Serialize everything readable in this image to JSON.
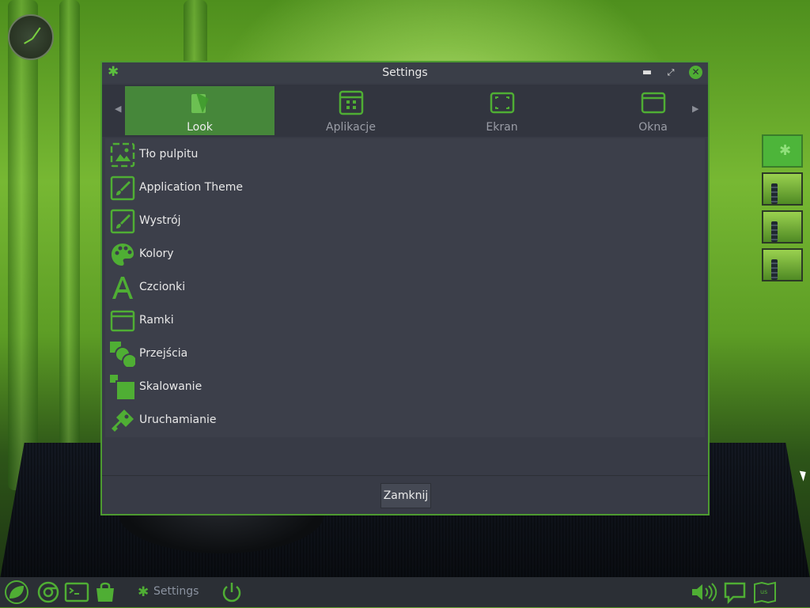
{
  "window": {
    "title": "Settings",
    "close_label": "Zamknij"
  },
  "tabs": [
    {
      "label": "Look",
      "icon": "look-icon",
      "active": true
    },
    {
      "label": "Aplikacje",
      "icon": "apps-grid-icon",
      "active": false
    },
    {
      "label": "Ekran",
      "icon": "screen-icon",
      "active": false
    },
    {
      "label": "Okna",
      "icon": "window-icon",
      "active": false
    }
  ],
  "items": [
    {
      "label": "Tło pulpitu",
      "icon": "wallpaper-icon"
    },
    {
      "label": "Application Theme",
      "icon": "theme-brush-icon"
    },
    {
      "label": "Wystrój",
      "icon": "brush-icon"
    },
    {
      "label": "Kolory",
      "icon": "palette-icon"
    },
    {
      "label": "Czcionki",
      "icon": "font-icon"
    },
    {
      "label": "Ramki",
      "icon": "frame-icon"
    },
    {
      "label": "Przejścia",
      "icon": "transitions-icon"
    },
    {
      "label": "Skalowanie",
      "icon": "scale-icon"
    },
    {
      "label": "Uruchamianie",
      "icon": "launch-icon"
    }
  ],
  "taskbar": {
    "settings_label": "Settings",
    "keyboard_layout": "us"
  },
  "colors": {
    "accent": "#4fae34",
    "window_bg": "#383b46",
    "list_bg": "#3c3f4a",
    "active_tab": "#46873a"
  }
}
